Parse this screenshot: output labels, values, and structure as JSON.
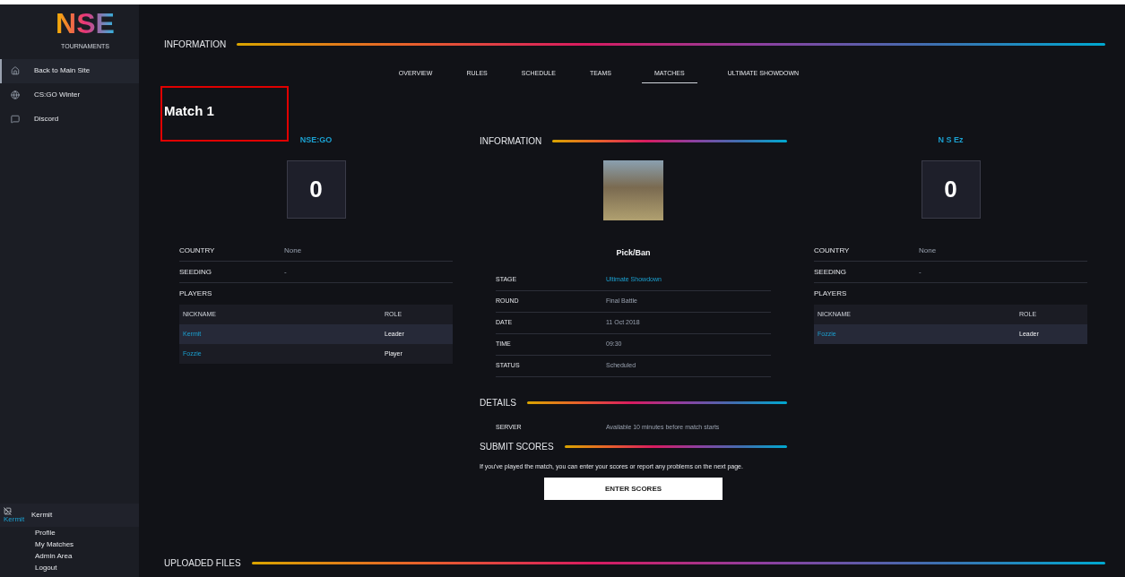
{
  "sidebar": {
    "logo": "NSE",
    "logo_subtitle": "TOURNAMENTS",
    "items": [
      {
        "label": "Back to Main Site",
        "selected": true
      },
      {
        "label": "CS:GO Winter",
        "selected": false
      },
      {
        "label": "Discord",
        "selected": false
      }
    ],
    "user": {
      "avatar_alt": "Kermit",
      "name": "Kermit"
    },
    "user_links": [
      "Profile",
      "My Matches",
      "Admin Area",
      "Logout"
    ]
  },
  "section_title": "INFORMATION",
  "tabs": [
    {
      "label": "OVERVIEW",
      "selected": false
    },
    {
      "label": "RULES",
      "selected": false
    },
    {
      "label": "SCHEDULE",
      "selected": false
    },
    {
      "label": "TEAMS",
      "selected": false
    },
    {
      "label": "MATCHES",
      "selected": true
    },
    {
      "label": "ULTIMATE SHOWDOWN",
      "selected": false
    }
  ],
  "match_title": "Match 1",
  "teams": [
    {
      "name": "NSE:GO",
      "score": "0",
      "details": [
        {
          "label": "COUNTRY",
          "value": "None"
        },
        {
          "label": "SEEDING",
          "value": "-"
        }
      ],
      "players_label": "PLAYERS",
      "columns": [
        "NICKNAME",
        "ROLE"
      ],
      "players": [
        {
          "nickname": "Kermit",
          "role": "Leader"
        },
        {
          "nickname": "Fozzie",
          "role": "Player"
        }
      ]
    },
    {
      "name": "N S Ez",
      "score": "0",
      "details": [
        {
          "label": "COUNTRY",
          "value": "None"
        },
        {
          "label": "SEEDING",
          "value": "-"
        }
      ],
      "players_label": "PLAYERS",
      "columns": [
        "NICKNAME",
        "ROLE"
      ],
      "players": [
        {
          "nickname": "Fozzie",
          "role": "Leader"
        }
      ]
    }
  ],
  "info": {
    "title": "INFORMATION",
    "map_caption": "Pick/Ban",
    "rows": [
      {
        "label": "STAGE",
        "value": "Ultimate Showdown",
        "link": true
      },
      {
        "label": "ROUND",
        "value": "Final Battle",
        "link": false
      },
      {
        "label": "DATE",
        "value": "11 Oct 2018",
        "link": false
      },
      {
        "label": "TIME",
        "value": "09:30",
        "link": false
      },
      {
        "label": "STATUS",
        "value": "Scheduled",
        "link": false
      }
    ]
  },
  "details": {
    "title": "DETAILS",
    "rows": [
      {
        "label": "SERVER",
        "value": "Available 10 minutes before match starts"
      }
    ]
  },
  "submit": {
    "title": "SUBMIT SCORES",
    "text": "If you've played the match, you can enter your scores or report any problems on the next page.",
    "button": "ENTER SCORES"
  },
  "uploaded_title": "UPLOADED FILES"
}
